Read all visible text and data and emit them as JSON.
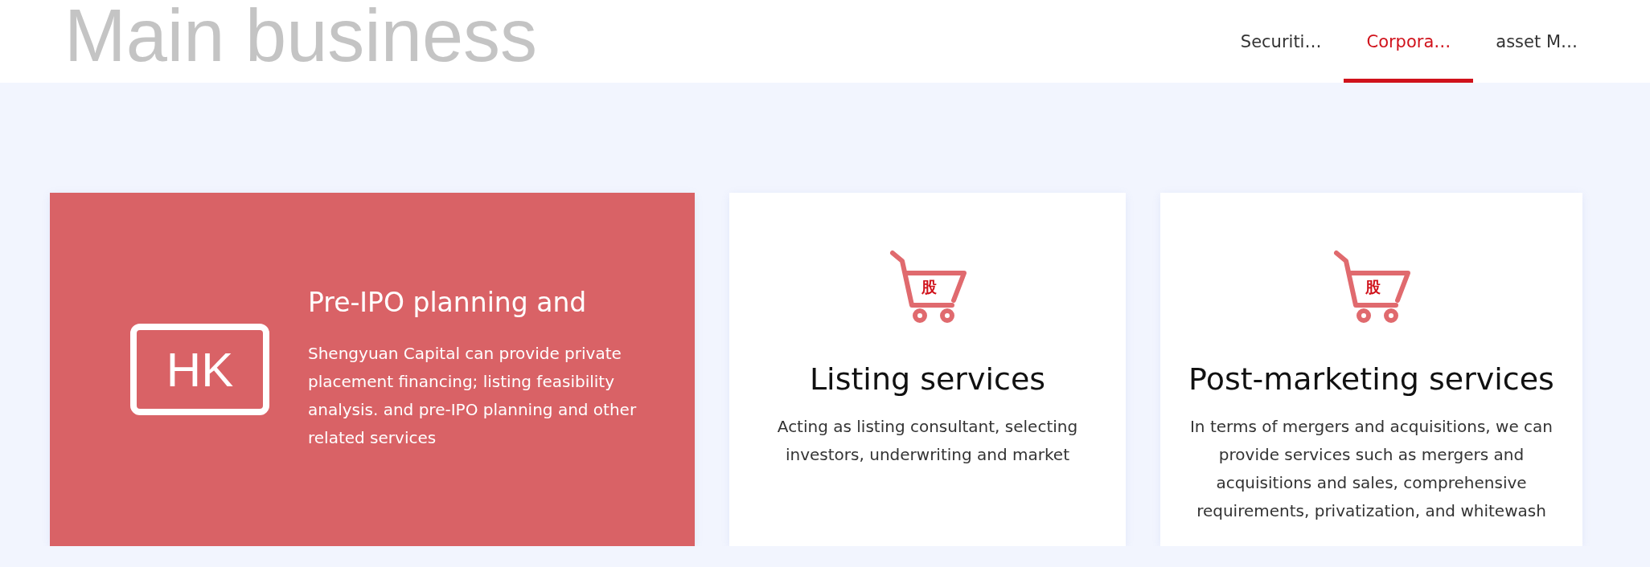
{
  "header": {
    "title": "Main business",
    "tabs": [
      {
        "label": "Securiti…",
        "selected": false
      },
      {
        "label": "Corpora…",
        "selected": true
      },
      {
        "label": "asset M…",
        "selected": false
      }
    ]
  },
  "cards": [
    {
      "kind": "highlight",
      "badge": "HK",
      "title": "Pre-IPO planning and",
      "description": "Shengyuan Capital can provide private placement financing; listing feasibility analysis. and pre-IPO planning and other related services"
    },
    {
      "kind": "plain",
      "badge": "股",
      "title": "Listing services",
      "description": "Acting as listing consultant, selecting investors, underwriting and market"
    },
    {
      "kind": "plain",
      "badge": "股",
      "title": "Post-marketing services",
      "description": "In terms of mergers and acquisitions, we can provide services such as mergers and acquisitions and sales, comprehensive requirements, privatization, and whitewash"
    }
  ]
}
